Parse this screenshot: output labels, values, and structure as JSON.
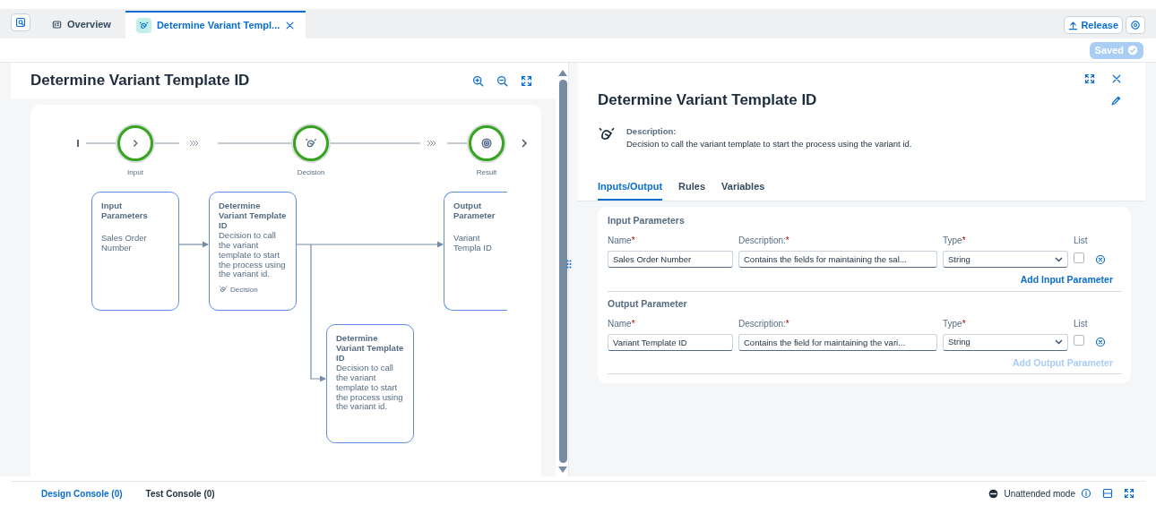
{
  "tab_bar": {
    "tabs": [
      {
        "label": "Overview",
        "selected": false,
        "closable": false
      },
      {
        "label": "Determine Variant Templ...",
        "selected": true,
        "closable": true
      }
    ],
    "release": "Release"
  },
  "toolbar": {
    "save_status": "Saved"
  },
  "editor": {
    "title": "Determine Variant Template ID",
    "steps": [
      {
        "label": "Input",
        "kind": "input",
        "complete": true
      },
      {
        "label": "Decision",
        "kind": "decision",
        "complete": true
      },
      {
        "label": "Result",
        "kind": "result",
        "complete": true
      }
    ],
    "nodes": [
      {
        "title": "Input Parameters",
        "body": "Sales Order Number"
      },
      {
        "title": "Determine Variant Template ID",
        "body": "Decision to call the variant template to start the process using the variant id.",
        "footer": "Decision"
      },
      {
        "title": "Determine Variant Template ID",
        "body": "Decision to call the variant template to start the process using the variant id."
      },
      {
        "title": "Output Parameter",
        "body": "Variant Templa ID"
      }
    ]
  },
  "details": {
    "title": "Determine Variant Template ID",
    "description_label": "Description:",
    "description": "Decision to call the variant template to start the process using the variant id.",
    "tabs": [
      {
        "label": "Inputs/Output",
        "selected": true
      },
      {
        "label": "Rules",
        "selected": false
      },
      {
        "label": "Variables",
        "selected": false
      }
    ],
    "sections": [
      {
        "title": "Input Parameters",
        "columns": [
          {
            "label": "Name",
            "mark": "*"
          },
          {
            "label": "Description:",
            "mark": "*"
          },
          {
            "label": "Type",
            "mark": "*"
          },
          {
            "label": "List"
          }
        ],
        "rows": [
          {
            "name": "Sales Order Number",
            "description": "Contains the fields for maintaining the sal...",
            "type": "String",
            "list": false
          }
        ],
        "add_label": "Add Input Parameter",
        "add_disabled": false
      },
      {
        "title": "Output Parameter",
        "columns": [
          {
            "label": "Name",
            "mark": "*"
          },
          {
            "label": "Description:",
            "mark": "*"
          },
          {
            "label": "Type",
            "mark": "*"
          },
          {
            "label": "List"
          }
        ],
        "rows": [
          {
            "name": "Variant Template ID",
            "description": "Contains the field for maintaining the vari...",
            "type": "String",
            "list": false
          }
        ],
        "add_label": "Add Output Parameter",
        "add_disabled": true
      }
    ]
  },
  "console": {
    "tabs": [
      {
        "label": "Design Console (0)",
        "selected": true
      },
      {
        "label": "Test Console (0)",
        "selected": false
      }
    ],
    "mode": "Unattended mode"
  }
}
